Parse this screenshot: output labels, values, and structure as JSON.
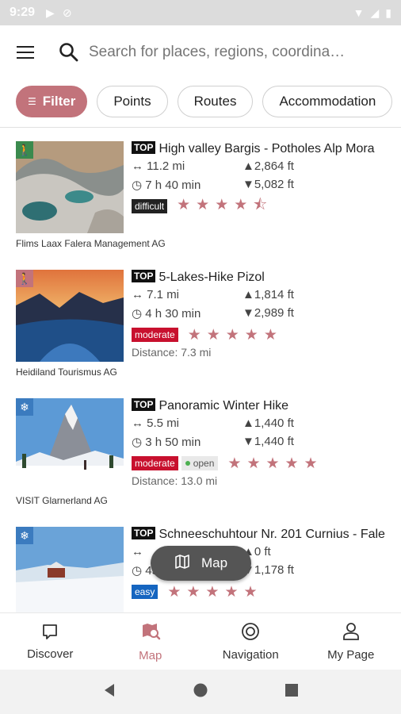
{
  "status": {
    "time": "9:29"
  },
  "search": {
    "placeholder": "Search for places, regions, coordina…"
  },
  "filters": {
    "filter_label": "Filter",
    "chips": [
      "Points",
      "Routes",
      "Accommodation"
    ]
  },
  "colors": {
    "accent": "#c2737b",
    "hike_icon_bg": "#c2737b",
    "winter_icon_bg": "#3b7bbf",
    "difficult": "#222222",
    "moderate": "#c8102e",
    "easy": "#1565c0"
  },
  "items": [
    {
      "category_icon": "hiking-icon",
      "top": "TOP",
      "title": "High valley Bargis - Potholes Alp Mora",
      "distance_length": "11.2 mi",
      "ascent": "2,864 ft",
      "duration": "7 h 40 min",
      "descent": "5,082 ft",
      "difficulty": "difficult",
      "rating": 4.5,
      "stars": "★★★★⯪",
      "organization": "Flims Laax Falera Management AG"
    },
    {
      "category_icon": "hiking-icon",
      "top": "TOP",
      "title": "5-Lakes-Hike Pizol",
      "distance_length": "7.1 mi",
      "ascent": "1,814 ft",
      "duration": "4 h 30 min",
      "descent": "2,989 ft",
      "difficulty": "moderate",
      "rating": 5,
      "stars": "★★★★★",
      "distance_away": "Distance: 7.3 mi",
      "organization": "Heidiland Tourismus AG"
    },
    {
      "category_icon": "winter-hiking-icon",
      "top": "TOP",
      "title": "Panoramic Winter Hike",
      "distance_length": "5.5 mi",
      "ascent": "1,440 ft",
      "duration": "3 h 50 min",
      "descent": "1,440 ft",
      "difficulty": "moderate",
      "status": "open",
      "rating": 5,
      "stars": "★★★★★",
      "distance_away": "Distance: 13.0 mi",
      "organization": "VISIT Glarnerland AG"
    },
    {
      "category_icon": "snowshoe-icon",
      "top": "TOP",
      "title": "Schneeschuhtour Nr. 201 Curnius - Fale",
      "distance_length": "",
      "ascent": "0 ft",
      "duration": "45 min",
      "descent": "1,178 ft",
      "difficulty": "easy",
      "rating": 5,
      "stars": "★★★★★"
    }
  ],
  "map_button": {
    "label": "Map"
  },
  "bottom_nav": [
    {
      "label": "Discover",
      "icon": "chat-bubble-icon"
    },
    {
      "label": "Map",
      "icon": "map-pin-icon",
      "active": true
    },
    {
      "label": "Navigation",
      "icon": "target-icon"
    },
    {
      "label": "My Page",
      "icon": "person-icon"
    }
  ]
}
